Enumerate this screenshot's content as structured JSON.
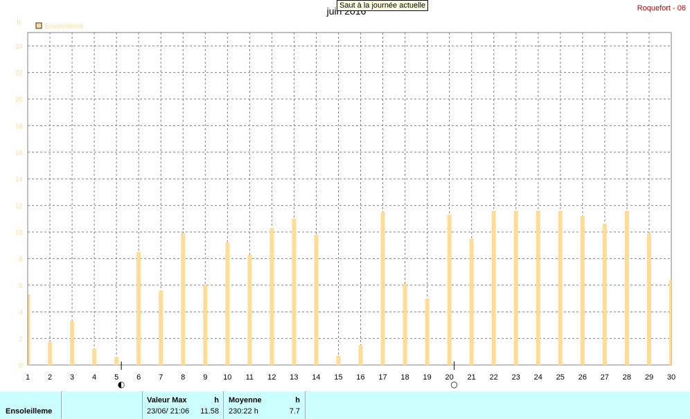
{
  "tooltip": "Saut à la journée actuelle",
  "station": "Roquefort - 06",
  "chart_data": {
    "type": "bar",
    "title": "juin 2016",
    "unit": "h",
    "legend": [
      "Ensoleilleme"
    ],
    "legend_position": "top-left",
    "grid": true,
    "ylim": [
      0,
      25
    ],
    "y_ticks": [
      0,
      2,
      4,
      6,
      8,
      10,
      12,
      14,
      16,
      18,
      20,
      22,
      24
    ],
    "categories": [
      "1",
      "2",
      "3",
      "4",
      "5",
      "6",
      "7",
      "8",
      "9",
      "10",
      "11",
      "12",
      "13",
      "14",
      "15",
      "16",
      "17",
      "18",
      "19",
      "20",
      "21",
      "22",
      "23",
      "24",
      "25",
      "26",
      "27",
      "28",
      "29",
      "30"
    ],
    "series": [
      {
        "name": "Ensoleilleme",
        "color": "#ffdc9a",
        "values": [
          5.3,
          1.7,
          3.3,
          1.2,
          0.6,
          8.5,
          5.6,
          9.9,
          6.0,
          9.2,
          8.3,
          10.3,
          11.0,
          9.8,
          0.7,
          1.5,
          11.5,
          6.1,
          5.0,
          11.3,
          9.5,
          11.6,
          11.6,
          11.6,
          11.6,
          11.2,
          10.6,
          11.6,
          9.9,
          6.4
        ]
      }
    ],
    "moon_phases": [
      {
        "day": "5",
        "symbol": "◐"
      },
      {
        "day": "20",
        "symbol": "○"
      }
    ]
  },
  "footer": {
    "label": "Ensoleilleme",
    "max": {
      "header": "Valeur Max",
      "unit": "h",
      "date": "23/06/  21:06",
      "value": "11.58"
    },
    "avg": {
      "header": "Moyenne",
      "unit": "h",
      "total": "230:22 h",
      "value": "7.7"
    }
  }
}
